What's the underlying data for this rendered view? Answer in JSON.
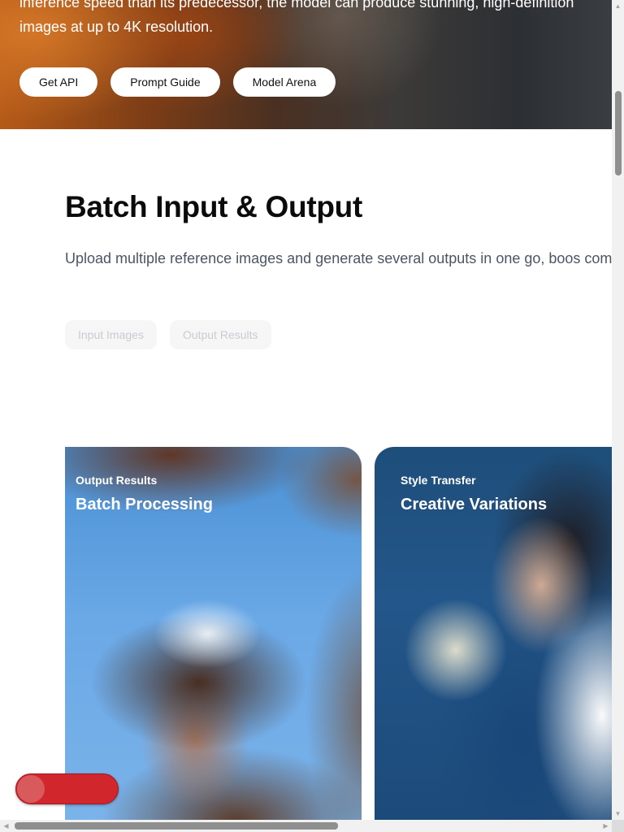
{
  "hero": {
    "description": "inference speed than its predecessor, the model can produce stunning, high-definition images at up to 4K resolution.",
    "buttons": {
      "get_api": "Get API",
      "prompt_guide": "Prompt Guide",
      "model_arena": "Model Arena"
    }
  },
  "section": {
    "title": "Batch Input & Output",
    "description": "Upload multiple reference images and generate several outputs in one go, boos combined results.)",
    "tabs": [
      {
        "label": "Input Images"
      },
      {
        "label": "Output Results"
      }
    ]
  },
  "cards": [
    {
      "kicker": "Output Results",
      "title": "Batch Processing"
    },
    {
      "kicker": "Style Transfer",
      "title": "Creative Variations"
    }
  ],
  "colors": {
    "toggle_accent": "#d0262c",
    "text_muted": "#4b5563",
    "tab_text": "#c8ccd2"
  },
  "scrollbar_icons": {
    "up": "triangle-up-icon",
    "down": "triangle-down-icon",
    "left": "triangle-left-icon",
    "right": "triangle-right-icon"
  }
}
